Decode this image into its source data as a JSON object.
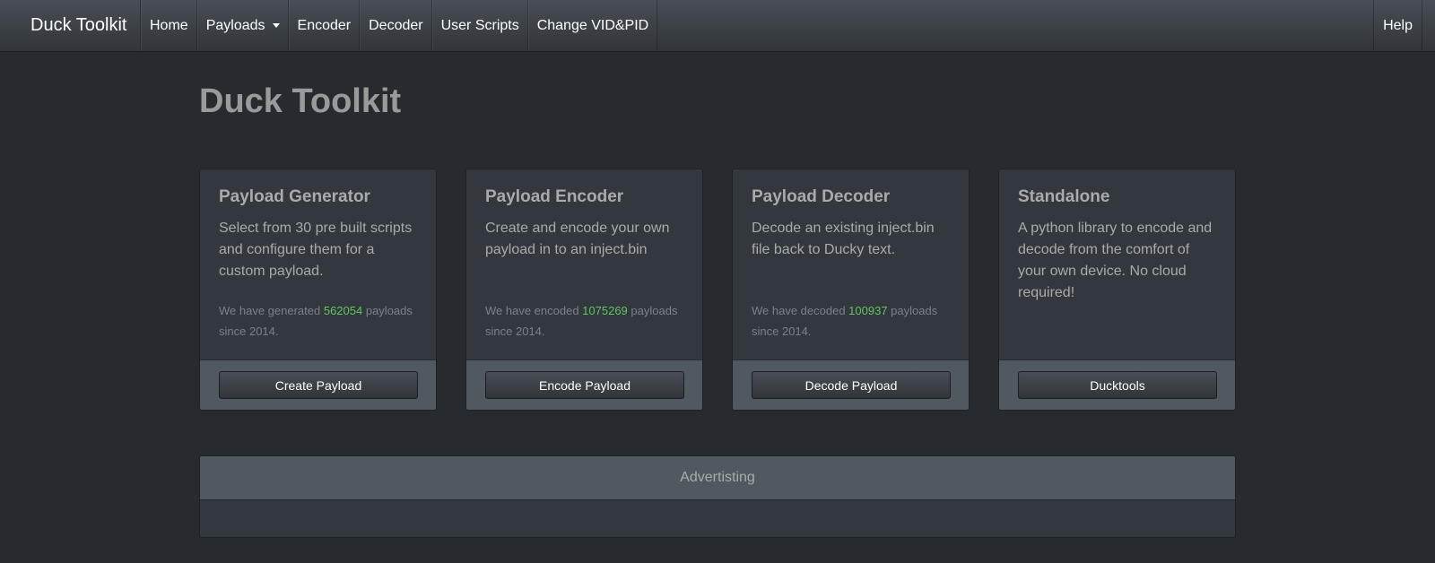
{
  "navbar": {
    "brand": "Duck Toolkit",
    "items": [
      {
        "label": "Home"
      },
      {
        "label": "Payloads"
      },
      {
        "label": "Encoder"
      },
      {
        "label": "Decoder"
      },
      {
        "label": "User Scripts"
      },
      {
        "label": "Change VID&PID"
      }
    ],
    "help": "Help"
  },
  "page": {
    "title": "Duck Toolkit"
  },
  "cards": [
    {
      "title": "Payload Generator",
      "text": "Select from 30 pre built scripts and configure them for a custom payload.",
      "stat_prefix": "We have generated ",
      "stat_number": "562054",
      "stat_suffix": " payloads since 2014.",
      "button": "Create Payload"
    },
    {
      "title": "Payload Encoder",
      "text": "Create and encode your own payload in to an inject.bin",
      "stat_prefix": "We have encoded ",
      "stat_number": "1075269",
      "stat_suffix": " payloads since 2014.",
      "button": "Encode Payload"
    },
    {
      "title": "Payload Decoder",
      "text": "Decode an existing inject.bin file back to Ducky text.",
      "stat_prefix": "We have decoded ",
      "stat_number": "100937",
      "stat_suffix": " payloads since 2014.",
      "button": "Decode Payload"
    },
    {
      "title": "Standalone",
      "text": "A python library to encode and decode from the comfort of your own device. No cloud required!",
      "button": "Ducktools"
    }
  ],
  "advertising": {
    "heading": "Advertisting"
  },
  "colors": {
    "background": "#272b30",
    "card": "#32383e",
    "card_footer": "#515960",
    "stat_number": "#62c462"
  }
}
